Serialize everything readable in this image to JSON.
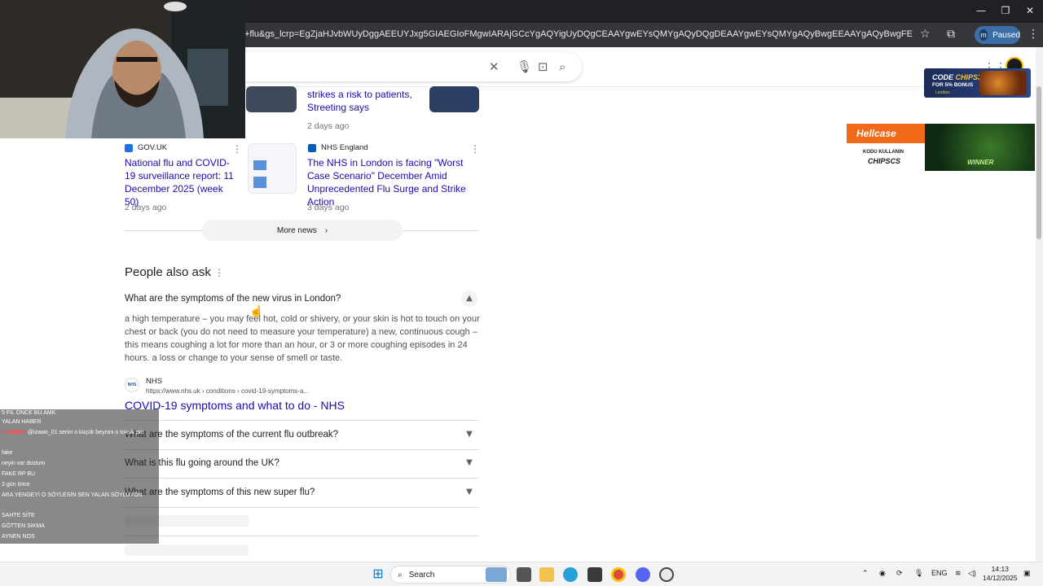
{
  "browser": {
    "url": "+flu&gs_lcrp=EgZjaHJvbWUyDggAEEUYJxg5GIAEGIoFMgwIARAjGCcYgAQYigUyDQgCEAAYgwEYsQMYgAQyDQgDEAAYgwEYsQMYgAQyBwgEEAAYgAQyBwgFEAAYgAQyBwgGEAAYgAQyBwgHEAAYgA...",
    "profile_initial": "m",
    "profile_status": "Paused",
    "window_controls": [
      "—",
      "❐",
      "✕"
    ]
  },
  "news": {
    "top_left_title": "",
    "top_right_title": "strikes a risk to patients, Streeting says",
    "top_right_age": "2 days ago",
    "cards": [
      {
        "source": "GOV.UK",
        "title": "National flu and COVID-19 surveillance report: 11 December 2025 (week 50)",
        "age": "2 days ago"
      },
      {
        "source": "NHS England",
        "title": "The NHS in London is facing \"Worst Case Scenario\" December Amid Unprecedented Flu Surge and Strike Action",
        "age": "3 days ago"
      }
    ],
    "more_label": "More news"
  },
  "paa": {
    "title": "People also ask",
    "expanded_question": "What are the symptoms of the new virus in London?",
    "answer": "a high temperature – you may feel hot, cold or shivery, or your skin is hot to touch on your chest or back (you do not need to measure your temperature) a new, continuous cough – this means coughing a lot for more than an hour, or 3 or more coughing episodes in 24 hours. a loss or change to your sense of smell or taste.",
    "source_name": "NHS",
    "source_logo": "NHS",
    "source_url": "https://www.nhs.uk › conditions › covid-19-symptoms-a...",
    "source_link": "COVID-19 symptoms and what to do - NHS",
    "questions": [
      "What are the symptoms of the current flu outbreak?",
      "What is this flu going around the UK?",
      "What are the symptoms of this new super flu?"
    ]
  },
  "ads": {
    "ad1_code": "CODE",
    "ad1_code_value": "CHIPS31",
    "ad1_bonus": "FOR 5% BONUS",
    "ad1_brand": "Lootbox",
    "ad2_brand": "Hellcase",
    "ad2_line1": "KODU KULLANIN",
    "ad2_line2": "CHIPSCS",
    "ad3_text": "WINNER"
  },
  "chat": [
    {
      "user": "",
      "msg": "5 FIL ÖNCE BU AMK",
      "color": "#bbbbbb"
    },
    {
      "user": "",
      "msg": "YALAN HABER",
      "color": "#4fc3f7"
    },
    {
      "user": "furkntmll",
      "msg": "@izawo_01 senin o küçük beynini o toksik pic",
      "color": "#ff4d4d"
    },
    {
      "user": "",
      "msg": "fake",
      "color": "#f6c343"
    },
    {
      "user": "",
      "msg": "neyin var dostum",
      "color": "#b388ff"
    },
    {
      "user": "",
      "msg": "FAKE RP BU",
      "color": "#ff8a65"
    },
    {
      "user": "",
      "msg": "3 gün önce",
      "color": "#64b5f6"
    },
    {
      "user": "",
      "msg": "ARA YENGEYİ O SÖYLESİN SEN YALAN SÖYLÜYON",
      "color": "#4dd0e1"
    },
    {
      "user": "",
      "msg": "SAHTE SİTE",
      "color": "#81c784"
    },
    {
      "user": "",
      "msg": "GÖTTEN SIKMA",
      "color": "#ffb74d"
    },
    {
      "user": "",
      "msg": "AYNEN NOS",
      "color": "#ba68c8"
    }
  ],
  "taskbar": {
    "search_label": "Search",
    "lang": "ENG",
    "time": "14:13",
    "date": "14/12/2025"
  }
}
